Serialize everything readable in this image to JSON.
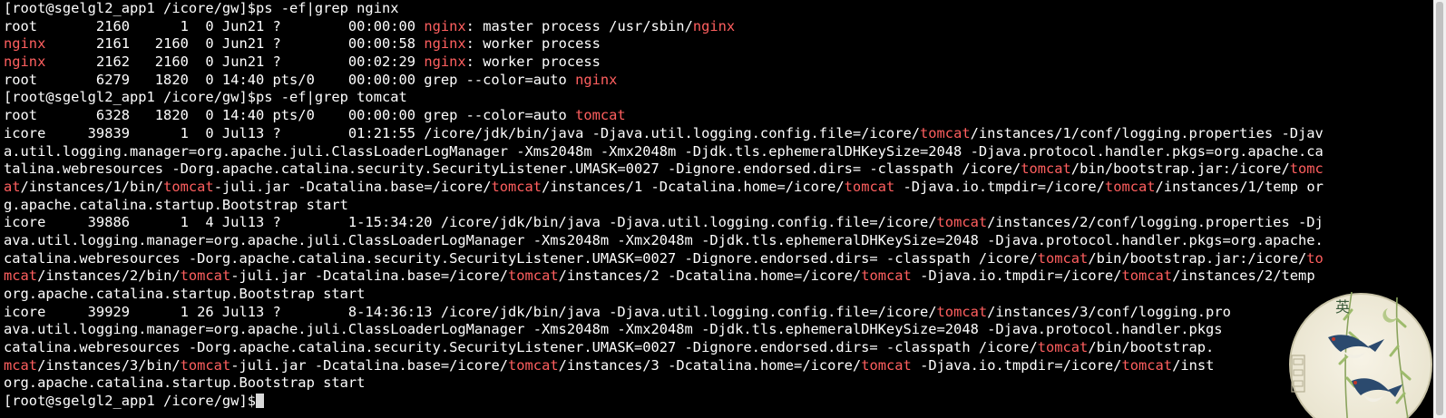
{
  "terminal": {
    "colors": {
      "background": "#000000",
      "text": "#ffffff",
      "highlight": "#ff5f5f"
    },
    "lines": [
      {
        "segments": [
          {
            "text": "[root@sgelgl2_app1 /icore/gw]$ps -ef|grep nginx",
            "hl": false
          }
        ]
      },
      {
        "segments": [
          {
            "text": "root       2160      1  0 Jun21 ?        00:00:00 ",
            "hl": false
          },
          {
            "text": "nginx",
            "hl": true
          },
          {
            "text": ": master process /usr/sbin/",
            "hl": false
          },
          {
            "text": "nginx",
            "hl": true
          }
        ]
      },
      {
        "segments": [
          {
            "text": "nginx",
            "hl": true
          },
          {
            "text": "      2161   2160  0 Jun21 ?        00:00:58 ",
            "hl": false
          },
          {
            "text": "nginx",
            "hl": true
          },
          {
            "text": ": worker process",
            "hl": false
          }
        ]
      },
      {
        "segments": [
          {
            "text": "nginx",
            "hl": true
          },
          {
            "text": "      2162   2160  0 Jun21 ?        00:02:29 ",
            "hl": false
          },
          {
            "text": "nginx",
            "hl": true
          },
          {
            "text": ": worker process",
            "hl": false
          }
        ]
      },
      {
        "segments": [
          {
            "text": "root       6279   1820  0 14:40 pts/0    00:00:00 grep --color=auto ",
            "hl": false
          },
          {
            "text": "nginx",
            "hl": true
          }
        ]
      },
      {
        "segments": [
          {
            "text": "[root@sgelgl2_app1 /icore/gw]$ps -ef|grep tomcat",
            "hl": false
          }
        ]
      },
      {
        "segments": [
          {
            "text": "root       6328   1820  0 14:40 pts/0    00:00:00 grep --color=auto ",
            "hl": false
          },
          {
            "text": "tomcat",
            "hl": true
          }
        ]
      },
      {
        "segments": [
          {
            "text": "icore     39839      1  0 Jul13 ?        01:21:55 /icore/jdk/bin/java -Djava.util.logging.config.file=/icore/",
            "hl": false
          },
          {
            "text": "tomcat",
            "hl": true
          },
          {
            "text": "/instances/1/conf/logging.properties -Djav",
            "hl": false
          }
        ]
      },
      {
        "segments": [
          {
            "text": "a.util.logging.manager=org.apache.juli.ClassLoaderLogManager -Xms2048m -Xmx2048m -Djdk.tls.ephemeralDHKeySize=2048 -Djava.protocol.handler.pkgs=org.apache.ca",
            "hl": false
          }
        ]
      },
      {
        "segments": [
          {
            "text": "talina.webresources -Dorg.apache.catalina.security.SecurityListener.UMASK=0027 -Dignore.endorsed.dirs= -classpath /icore/",
            "hl": false
          },
          {
            "text": "tomcat",
            "hl": true
          },
          {
            "text": "/bin/bootstrap.jar:/icore/",
            "hl": false
          },
          {
            "text": "tomc",
            "hl": true
          }
        ]
      },
      {
        "segments": [
          {
            "text": "at",
            "hl": true
          },
          {
            "text": "/instances/1/bin/",
            "hl": false
          },
          {
            "text": "tomcat",
            "hl": true
          },
          {
            "text": "-juli.jar -Dcatalina.base=/icore/",
            "hl": false
          },
          {
            "text": "tomcat",
            "hl": true
          },
          {
            "text": "/instances/1 -Dcatalina.home=/icore/",
            "hl": false
          },
          {
            "text": "tomcat",
            "hl": true
          },
          {
            "text": " -Djava.io.tmpdir=/icore/",
            "hl": false
          },
          {
            "text": "tomcat",
            "hl": true
          },
          {
            "text": "/instances/1/temp or",
            "hl": false
          }
        ]
      },
      {
        "segments": [
          {
            "text": "g.apache.catalina.startup.Bootstrap start",
            "hl": false
          }
        ]
      },
      {
        "segments": [
          {
            "text": "icore     39886      1  4 Jul13 ?        1-15:34:20 /icore/jdk/bin/java -Djava.util.logging.config.file=/icore/",
            "hl": false
          },
          {
            "text": "tomcat",
            "hl": true
          },
          {
            "text": "/instances/2/conf/logging.properties -Dj",
            "hl": false
          }
        ]
      },
      {
        "segments": [
          {
            "text": "ava.util.logging.manager=org.apache.juli.ClassLoaderLogManager -Xms2048m -Xmx2048m -Djdk.tls.ephemeralDHKeySize=2048 -Djava.protocol.handler.pkgs=org.apache.",
            "hl": false
          }
        ]
      },
      {
        "segments": [
          {
            "text": "catalina.webresources -Dorg.apache.catalina.security.SecurityListener.UMASK=0027 -Dignore.endorsed.dirs= -classpath /icore/",
            "hl": false
          },
          {
            "text": "tomcat",
            "hl": true
          },
          {
            "text": "/bin/bootstrap.jar:/icore/",
            "hl": false
          },
          {
            "text": "to",
            "hl": true
          }
        ]
      },
      {
        "segments": [
          {
            "text": "mcat",
            "hl": true
          },
          {
            "text": "/instances/2/bin/",
            "hl": false
          },
          {
            "text": "tomcat",
            "hl": true
          },
          {
            "text": "-juli.jar -Dcatalina.base=/icore/",
            "hl": false
          },
          {
            "text": "tomcat",
            "hl": true
          },
          {
            "text": "/instances/2 -Dcatalina.home=/icore/",
            "hl": false
          },
          {
            "text": "tomcat",
            "hl": true
          },
          {
            "text": " -Djava.io.tmpdir=/icore/",
            "hl": false
          },
          {
            "text": "tomcat",
            "hl": true
          },
          {
            "text": "/instances/2/temp",
            "hl": false
          }
        ]
      },
      {
        "segments": [
          {
            "text": "org.apache.catalina.startup.Bootstrap start",
            "hl": false
          }
        ]
      },
      {
        "segments": [
          {
            "text": "icore     39929      1 26 Jul13 ?        8-14:36:13 /icore/jdk/bin/java -Djava.util.logging.config.file=/icore/",
            "hl": false
          },
          {
            "text": "tomcat",
            "hl": true
          },
          {
            "text": "/instances/3/conf/logging.pro",
            "hl": false
          }
        ]
      },
      {
        "segments": [
          {
            "text": "ava.util.logging.manager=org.apache.juli.ClassLoaderLogManager -Xms2048m -Xmx2048m -Djdk.tls.ephemeralDHKeySize=2048 -Djava.protocol.handler.pkgs",
            "hl": false
          }
        ]
      },
      {
        "segments": [
          {
            "text": "catalina.webresources -Dorg.apache.catalina.security.SecurityListener.UMASK=0027 -Dignore.endorsed.dirs= -classpath /icore/",
            "hl": false
          },
          {
            "text": "tomcat",
            "hl": true
          },
          {
            "text": "/bin/bootstrap.",
            "hl": false
          }
        ]
      },
      {
        "segments": [
          {
            "text": "mcat",
            "hl": true
          },
          {
            "text": "/instances/3/bin/",
            "hl": false
          },
          {
            "text": "tomcat",
            "hl": true
          },
          {
            "text": "-juli.jar -Dcatalina.base=/icore/",
            "hl": false
          },
          {
            "text": "tomcat",
            "hl": true
          },
          {
            "text": "/instances/3 -Dcatalina.home=/icore/",
            "hl": false
          },
          {
            "text": "tomcat",
            "hl": true
          },
          {
            "text": " -Djava.io.tmpdir=/icore/",
            "hl": false
          },
          {
            "text": "tomcat",
            "hl": true
          },
          {
            "text": "/inst",
            "hl": false
          }
        ]
      },
      {
        "segments": [
          {
            "text": "org.apache.catalina.startup.Bootstrap start",
            "hl": false
          }
        ]
      },
      {
        "segments": [
          {
            "text": "[root@sgelgl2_app1 /icore/gw]$",
            "hl": false
          }
        ],
        "cursor": true
      }
    ]
  },
  "stamp": {
    "icon": "swallow-willow-stamp-icon",
    "text": "英"
  }
}
